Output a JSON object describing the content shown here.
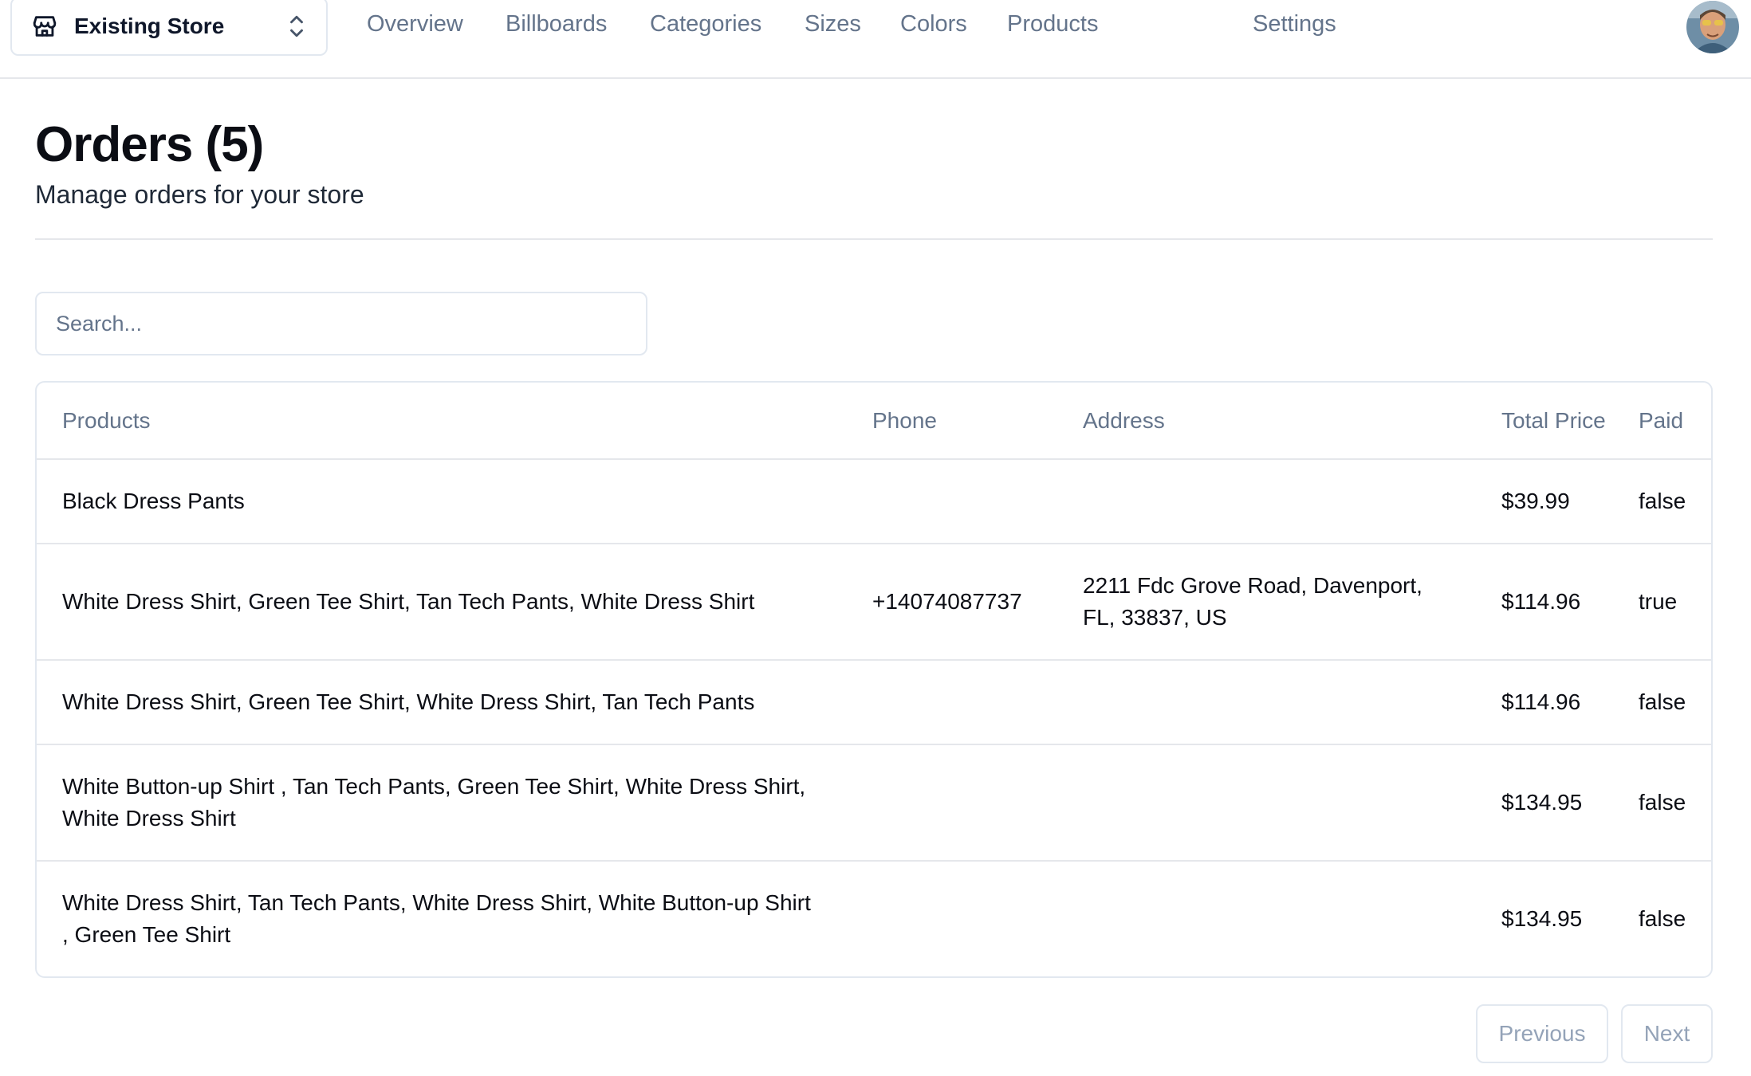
{
  "header": {
    "store_name": "Existing Store",
    "store_icon": "store-icon",
    "switcher_icon": "chevrons-up-down-icon",
    "nav": [
      {
        "label": "Overview"
      },
      {
        "label": "Billboards"
      },
      {
        "label": "Categories"
      },
      {
        "label": "Sizes"
      },
      {
        "label": "Colors"
      },
      {
        "label": "Products"
      },
      {
        "label": "Settings"
      }
    ],
    "avatar_icon": "user-avatar"
  },
  "page": {
    "title": "Orders (5)",
    "subtitle": "Manage orders for your store"
  },
  "search": {
    "placeholder": "Search...",
    "value": ""
  },
  "table": {
    "columns": [
      "Products",
      "Phone",
      "Address",
      "Total Price",
      "Paid"
    ],
    "rows": [
      {
        "products": "Black Dress Pants",
        "phone": "",
        "address": "",
        "total": "$39.99",
        "paid": "false"
      },
      {
        "products": "White Dress Shirt, Green Tee Shirt, Tan Tech Pants, White Dress Shirt",
        "phone": "+14074087737",
        "address": "2211 Fdc Grove Road, Davenport, FL, 33837, US",
        "total": "$114.96",
        "paid": "true"
      },
      {
        "products": "White Dress Shirt, Green Tee Shirt, White Dress Shirt, Tan Tech Pants",
        "phone": "",
        "address": "",
        "total": "$114.96",
        "paid": "false"
      },
      {
        "products": "White Button-up Shirt , Tan Tech Pants, Green Tee Shirt, White Dress Shirt, White Dress Shirt",
        "phone": "",
        "address": "",
        "total": "$134.95",
        "paid": "false"
      },
      {
        "products": "White Dress Shirt, Tan Tech Pants, White Dress Shirt, White Button-up Shirt , Green Tee Shirt",
        "phone": "",
        "address": "",
        "total": "$134.95",
        "paid": "false"
      }
    ]
  },
  "pagination": {
    "previous_label": "Previous",
    "next_label": "Next"
  },
  "colors": {
    "text_primary": "#0b0d14",
    "text_muted": "#64748b",
    "border": "#e2e8f0",
    "disabled": "#94a3b8"
  }
}
